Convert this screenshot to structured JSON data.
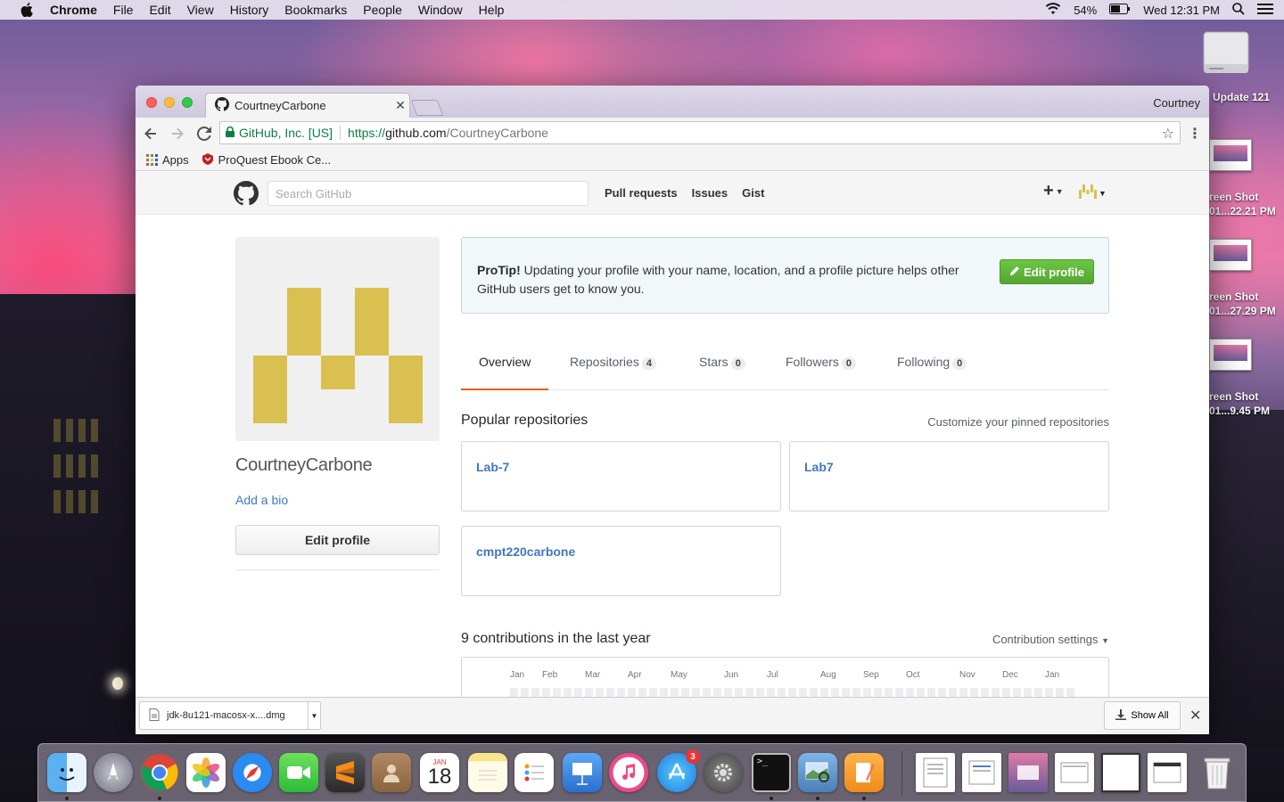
{
  "menubar": {
    "app_name": "Chrome",
    "items": [
      "File",
      "Edit",
      "View",
      "History",
      "Bookmarks",
      "People",
      "Window",
      "Help"
    ],
    "battery": "54%",
    "clock": "Wed 12:31 PM"
  },
  "desktop": {
    "drive_label": "Update 121",
    "screenshots": [
      "reen Shot",
      "01...22.21 PM",
      "reen Shot",
      "01...27.29 PM",
      "reen Shot",
      "01...9.45 PM"
    ]
  },
  "browser": {
    "tab_title": "CourtneyCarbone",
    "profile_name": "Courtney",
    "security_label": "GitHub, Inc. [US]",
    "url_scheme": "https://",
    "url_host": "github.com",
    "url_path": "/CourtneyCarbone",
    "bookmarks": [
      "Apps",
      "ProQuest Ebook Ce..."
    ]
  },
  "github": {
    "search_placeholder": "Search GitHub",
    "nav": [
      "Pull requests",
      "Issues",
      "Gist"
    ],
    "plus_icon": "+",
    "username": "CourtneyCarbone",
    "add_bio": "Add a bio",
    "edit_profile": "Edit profile",
    "protip": {
      "label": "ProTip!",
      "text": " Updating your profile with your name, location, and a profile picture helps other GitHub users get to know you.",
      "button": "Edit profile"
    },
    "tabs": [
      {
        "label": "Overview",
        "count": null
      },
      {
        "label": "Repositories",
        "count": "4"
      },
      {
        "label": "Stars",
        "count": "0"
      },
      {
        "label": "Followers",
        "count": "0"
      },
      {
        "label": "Following",
        "count": "0"
      }
    ],
    "popular_heading": "Popular repositories",
    "customize_link": "Customize your pinned repositories",
    "repos": [
      "Lab-7",
      "Lab7",
      "cmpt220carbone"
    ],
    "contrib_heading": "9 contributions in the last year",
    "contrib_settings": "Contribution settings",
    "months": [
      "Jan",
      "Feb",
      "Mar",
      "Apr",
      "May",
      "Jun",
      "Jul",
      "Aug",
      "Sep",
      "Oct",
      "Nov",
      "Dec",
      "Jan"
    ]
  },
  "downloads": {
    "file_name": "jdk-8u121-macosx-x....dmg",
    "show_all": "Show All"
  },
  "dock": {
    "calendar_month": "JAN",
    "calendar_day": "18",
    "appstore_badge": "3"
  },
  "colors": {
    "link_blue": "#4078c0",
    "github_green": "#6cc644",
    "tab_underline": "#e36209",
    "avatar_yellow": "#d9c050"
  }
}
